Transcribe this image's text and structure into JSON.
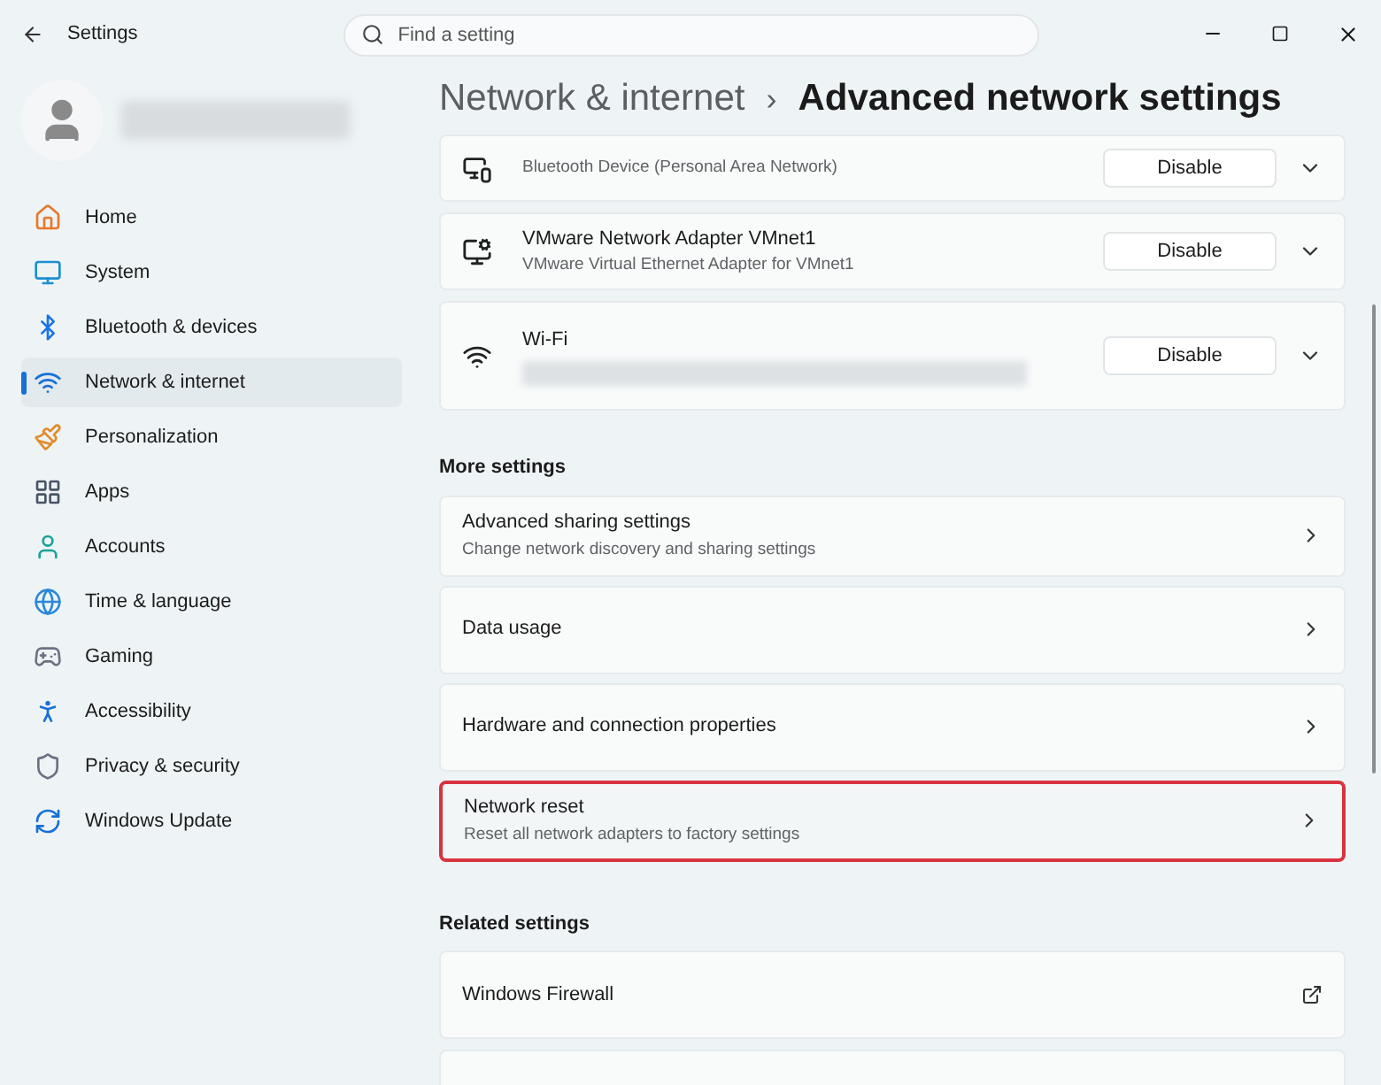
{
  "window": {
    "title": "Settings"
  },
  "search": {
    "placeholder": "Find a setting"
  },
  "sidebar": {
    "items": [
      {
        "label": "Home",
        "selected": false
      },
      {
        "label": "System",
        "selected": false
      },
      {
        "label": "Bluetooth & devices",
        "selected": false
      },
      {
        "label": "Network & internet",
        "selected": true
      },
      {
        "label": "Personalization",
        "selected": false
      },
      {
        "label": "Apps",
        "selected": false
      },
      {
        "label": "Accounts",
        "selected": false
      },
      {
        "label": "Time & language",
        "selected": false
      },
      {
        "label": "Gaming",
        "selected": false
      },
      {
        "label": "Accessibility",
        "selected": false
      },
      {
        "label": "Privacy & security",
        "selected": false
      },
      {
        "label": "Windows Update",
        "selected": false
      }
    ]
  },
  "breadcrumb": {
    "parent": "Network & internet",
    "separator": "›",
    "current": "Advanced network settings"
  },
  "adapters": [
    {
      "subtitle": "Bluetooth Device (Personal Area Network)",
      "button": "Disable"
    },
    {
      "title": "VMware Network Adapter VMnet1",
      "subtitle": "VMware Virtual Ethernet Adapter for VMnet1",
      "button": "Disable"
    },
    {
      "title": "Wi-Fi",
      "button": "Disable"
    }
  ],
  "sections": [
    {
      "heading": "More settings",
      "cards": [
        {
          "title": "Advanced sharing settings",
          "subtitle": "Change network discovery and sharing settings",
          "kind": "chevron",
          "highlighted": false
        },
        {
          "title": "Data usage",
          "kind": "chevron",
          "highlighted": false
        },
        {
          "title": "Hardware and connection properties",
          "kind": "chevron",
          "highlighted": false
        },
        {
          "title": "Network reset",
          "subtitle": "Reset all network adapters to factory settings",
          "kind": "chevron",
          "highlighted": true
        }
      ]
    },
    {
      "heading": "Related settings",
      "cards": [
        {
          "title": "Windows Firewall",
          "kind": "external",
          "highlighted": false
        }
      ]
    }
  ]
}
